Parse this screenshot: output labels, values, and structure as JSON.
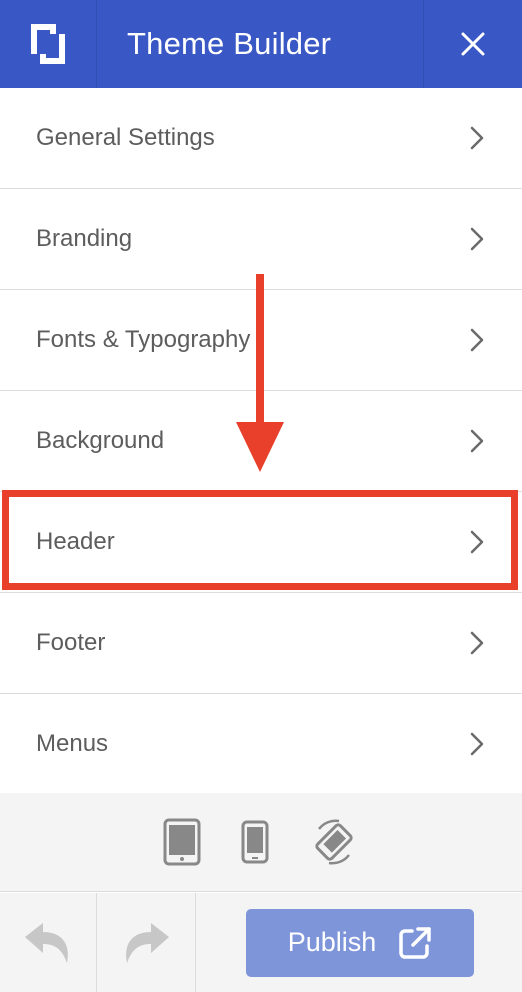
{
  "header": {
    "title": "Theme Builder",
    "logo_icon": "theme-logo-icon",
    "close_icon": "close-icon",
    "bg_color": "#3a58c5"
  },
  "menu": {
    "items": [
      {
        "label": "General Settings"
      },
      {
        "label": "Branding"
      },
      {
        "label": "Fonts & Typography"
      },
      {
        "label": "Background"
      },
      {
        "label": "Header"
      },
      {
        "label": "Footer"
      },
      {
        "label": "Menus"
      }
    ],
    "chevron_icon": "chevron-right-icon",
    "highlighted_item": "Header",
    "highlight_color": "#e8402a"
  },
  "devices": {
    "icons": [
      "tablet-icon",
      "phone-icon",
      "rotate-icon"
    ]
  },
  "footer": {
    "undo_icon": "undo-icon",
    "redo_icon": "redo-icon",
    "publish_label": "Publish",
    "publish_icon": "external-link-icon",
    "publish_color": "#7f95d9"
  }
}
